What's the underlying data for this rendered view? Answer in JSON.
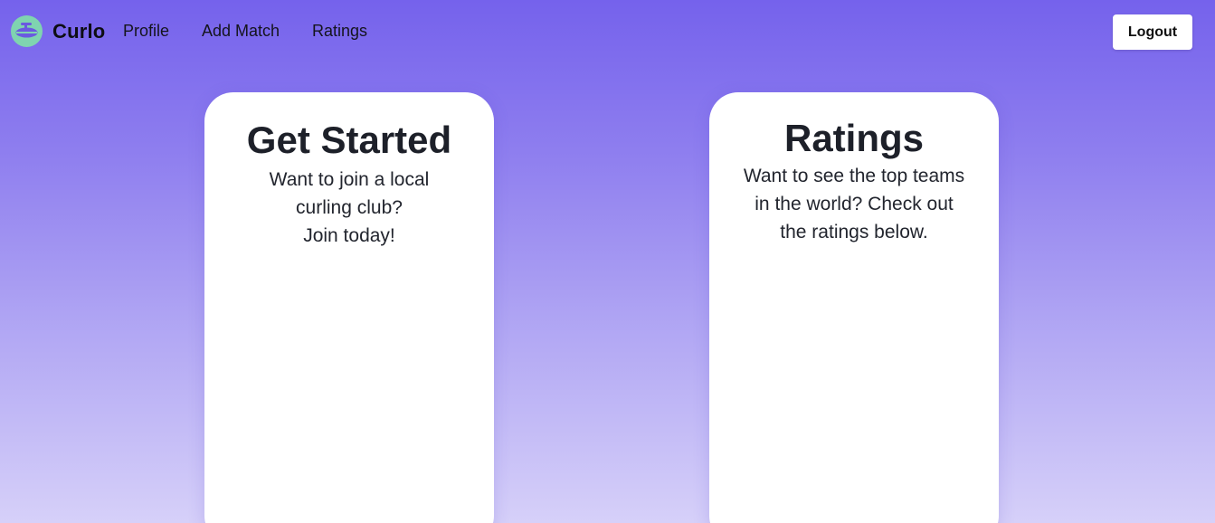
{
  "app": {
    "brand": "Curlo",
    "logo_icon": "curling-stone-icon",
    "logo_color": "#7fd4b0",
    "accent": "#7562ec"
  },
  "nav": {
    "links": [
      "Profile",
      "Add Match",
      "Ratings"
    ],
    "logout_label": "Logout"
  },
  "cards": {
    "get_started": {
      "title": "Get Started",
      "lines": [
        "Want to join a local",
        "curling club?",
        "Join today!"
      ]
    },
    "ratings": {
      "title": "Ratings",
      "lines": [
        "Want to see the top teams",
        "in the world? Check out",
        "the ratings below."
      ]
    }
  }
}
